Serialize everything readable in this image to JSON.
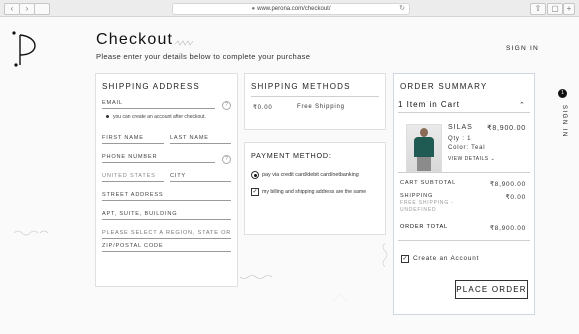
{
  "browser": {
    "url": "www.perona.com/checkout/",
    "back_glyph": "‹",
    "forward_glyph": "›",
    "reload_glyph": "↻"
  },
  "header": {
    "title": "Checkout",
    "subtitle": "Please enter your details below to complete your purchase",
    "signin": "SIGN IN"
  },
  "shipping_address": {
    "heading": "SHIPPING ADDRESS",
    "email_label": "EMAIL",
    "account_note": "you can create an account after checkout.",
    "first_name": "FIRST NAME",
    "last_name": "LAST NAME",
    "phone": "PHONE NUMBER",
    "country": "UNITED STATES",
    "city": "CITY",
    "street": "STREET ADDRESS",
    "apt": "APT, SUITE, BUILDING",
    "region": "PLEASE SELECT A REGION, STATE OR P",
    "zip": "ZIP/POSTAL CODE",
    "help_glyph": "?"
  },
  "shipping_methods": {
    "heading": "SHIPPING METHODS",
    "price": "₹0.00",
    "name": "Free Shipping"
  },
  "payment": {
    "heading": "PAYMENT METHOD:",
    "option": "pay via credit card/debit card/netbanking",
    "billing_same": "my billing and shipping address are the same",
    "check_glyph": "✓"
  },
  "order_summary": {
    "heading": "ORDER SUMMARY",
    "items_in_cart": "1 Item in Cart",
    "chevron_up": "⌃",
    "product": {
      "name": "SILAS",
      "price": "₹8,900.00",
      "qty": "Qty : 1",
      "color": "Color: Teal",
      "view_details": "VIEW DETAILS",
      "view_chevron": "⌄"
    },
    "cart_subtotal_label": "CART SUBTOTAL",
    "cart_subtotal_value": "₹8,900.00",
    "shipping_label": "SHIPPING",
    "shipping_sub": "FREE SHIPPING - UNDEFINED",
    "shipping_value": "₹0.00",
    "order_total_label": "ORDER TOTAL",
    "order_total_value": "₹8,900.00",
    "create_account": "Create an Account",
    "place_order": "PLACE ORDER"
  },
  "side_cart": {
    "count": "1",
    "label": "SIGN IN"
  },
  "colors": {
    "accent": "#111111",
    "teal": "#1f5a53"
  }
}
